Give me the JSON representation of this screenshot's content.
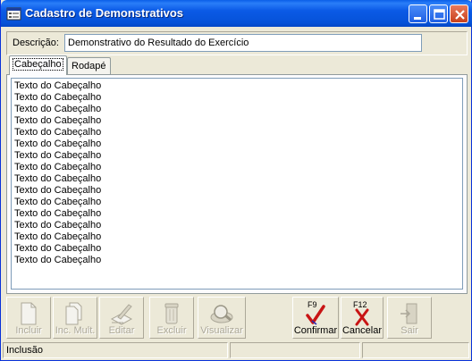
{
  "window": {
    "title": "Cadastro de Demonstrativos",
    "icon": "app-form-icon"
  },
  "description": {
    "label": "Descrição:",
    "value": "Demonstrativo do Resultado do Exercício"
  },
  "tabs": [
    {
      "label": "Cabeçalho",
      "active": true
    },
    {
      "label": "Rodapé",
      "active": false
    }
  ],
  "memo_lines": [
    "Texto do Cabeçalho",
    "Texto do Cabeçalho",
    "Texto do Cabeçalho",
    "Texto do Cabeçalho",
    "Texto do Cabeçalho",
    "Texto do Cabeçalho",
    "Texto do Cabeçalho",
    "Texto do Cabeçalho",
    "Texto do Cabeçalho",
    "Texto do Cabeçalho",
    "Texto do Cabeçalho",
    "Texto do Cabeçalho",
    "Texto do Cabeçalho",
    "Texto do Cabeçalho",
    "Texto do Cabeçalho",
    "Texto do Cabeçalho"
  ],
  "toolbar": {
    "incluir": "Incluir",
    "inc_mult": "Inc. Mult.",
    "editar": "Editar",
    "excluir": "Excluir",
    "visualizar": "Visualizar",
    "confirmar": "Confirmar",
    "confirmar_key": "F9",
    "cancelar": "Cancelar",
    "cancelar_key": "F12",
    "sair": "Sair"
  },
  "status": {
    "mode": "Inclusão",
    "panel2": "",
    "panel3": ""
  },
  "colors": {
    "title_bar": "#0a5ee8",
    "window_bg": "#ece9d8",
    "confirm_check": "#c81414",
    "cancel_x": "#c81414"
  }
}
